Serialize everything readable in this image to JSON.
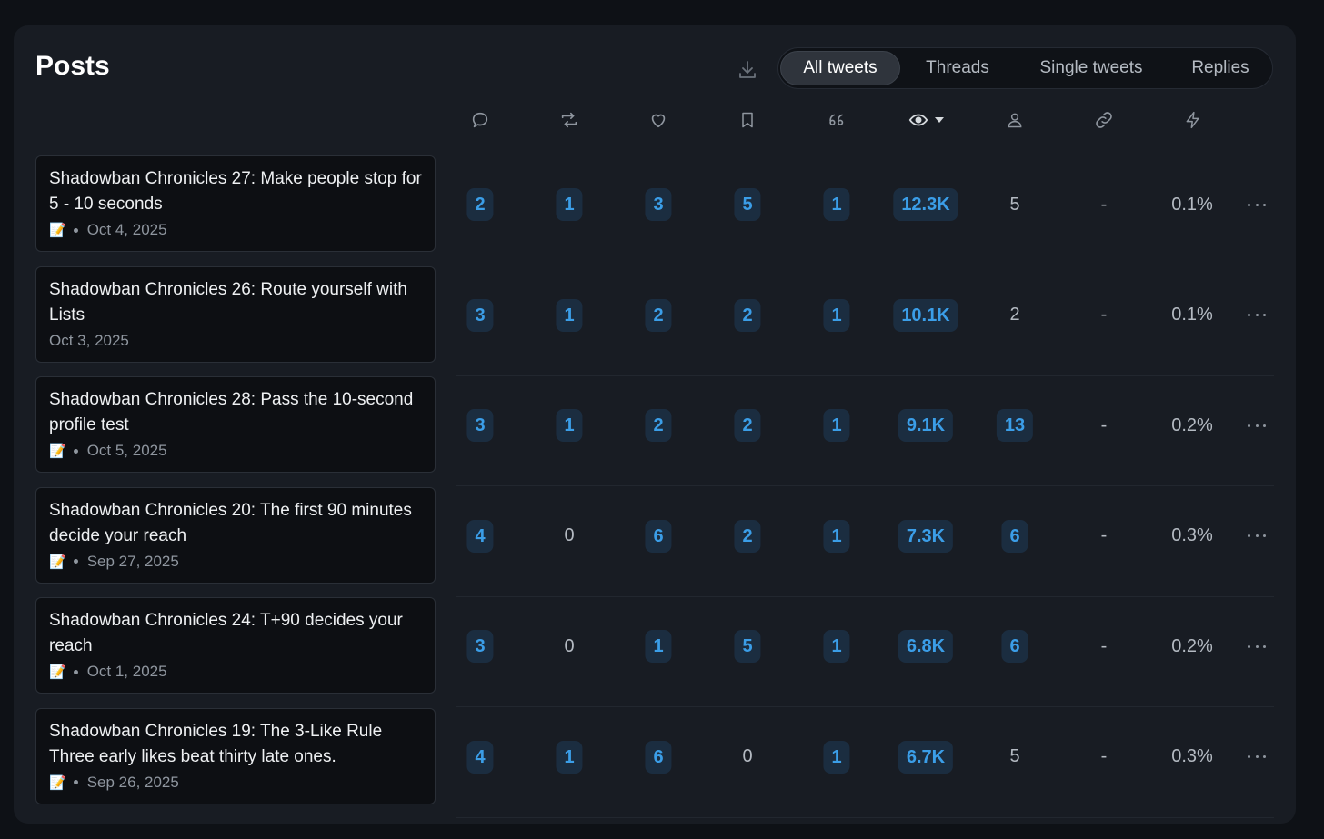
{
  "header": {
    "title": "Posts",
    "tabs": [
      {
        "label": "All tweets",
        "active": true
      },
      {
        "label": "Threads",
        "active": false
      },
      {
        "label": "Single tweets",
        "active": false
      },
      {
        "label": "Replies",
        "active": false
      }
    ]
  },
  "columns": [
    {
      "icon": "reply-icon"
    },
    {
      "icon": "retweet-icon"
    },
    {
      "icon": "heart-icon"
    },
    {
      "icon": "bookmark-icon"
    },
    {
      "icon": "quote-icon"
    },
    {
      "icon": "views-icon",
      "sorted": "desc"
    },
    {
      "icon": "profile-icon"
    },
    {
      "icon": "link-icon"
    },
    {
      "icon": "engagement-icon"
    }
  ],
  "posts": [
    {
      "title": "Shadowban Chronicles 27: Make people stop for 5 - 10 seconds",
      "memo": "📝",
      "date": "Oct 4, 2025",
      "metrics": [
        "2",
        "1",
        "3",
        "5",
        "1",
        "12.3K",
        "5",
        "-",
        "0.1%"
      ]
    },
    {
      "title": "Shadowban Chronicles 26: Route yourself with Lists",
      "memo": "",
      "date": "Oct 3, 2025",
      "metrics": [
        "3",
        "1",
        "2",
        "2",
        "1",
        "10.1K",
        "2",
        "-",
        "0.1%"
      ]
    },
    {
      "title": "Shadowban Chronicles 28: Pass the 10-second profile test",
      "memo": "📝",
      "date": "Oct 5, 2025",
      "metrics": [
        "3",
        "1",
        "2",
        "2",
        "1",
        "9.1K",
        "13",
        "-",
        "0.2%"
      ]
    },
    {
      "title": "Shadowban Chronicles 20: The first 90 minutes decide your reach",
      "memo": "📝",
      "date": "Sep 27, 2025",
      "metrics": [
        "4",
        "0",
        "6",
        "2",
        "1",
        "7.3K",
        "6",
        "-",
        "0.3%"
      ]
    },
    {
      "title": "Shadowban Chronicles 24: T+90 decides your reach",
      "memo": "📝",
      "date": "Oct 1, 2025",
      "metrics": [
        "3",
        "0",
        "1",
        "5",
        "1",
        "6.8K",
        "6",
        "-",
        "0.2%"
      ]
    },
    {
      "title": "Shadowban Chronicles 19: The 3-Like Rule Three early likes beat thirty late ones.",
      "memo": "📝",
      "date": "Sep 26, 2025",
      "metrics": [
        "4",
        "1",
        "6",
        "0",
        "1",
        "6.7K",
        "5",
        "-",
        "0.3%"
      ]
    }
  ],
  "colors": {
    "accent": "#3b9ee8",
    "pill_bg": "#1b2d40",
    "panel_bg": "#181c23"
  }
}
